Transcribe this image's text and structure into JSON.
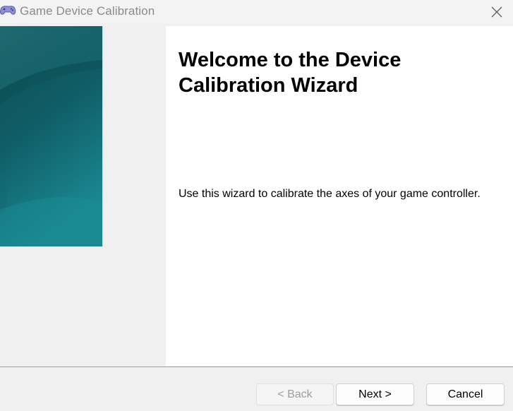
{
  "window": {
    "title": "Game Device Calibration",
    "app_icon": "gamepad-icon",
    "close_icon": "close-icon"
  },
  "wizard": {
    "heading": "Welcome to the Device Calibration Wizard",
    "description": "Use this wizard to calibrate the axes of your game controller."
  },
  "footer": {
    "back_label": "< Back",
    "next_label": "Next >",
    "cancel_label": "Cancel",
    "back_enabled": false
  },
  "colors": {
    "banner_top": "#0f5d60",
    "banner_bottom": "#1a8a92",
    "content_bg": "#ffffff",
    "window_bg": "#f0f0f0"
  }
}
